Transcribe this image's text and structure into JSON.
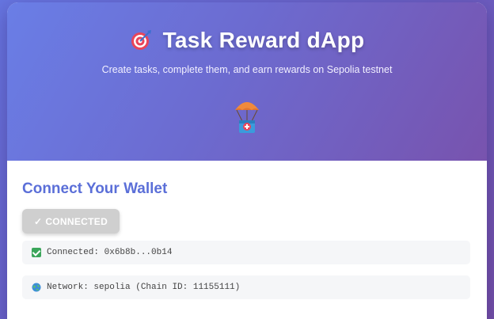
{
  "hero": {
    "title": "Task Reward dApp",
    "subtitle": "Create tasks, complete them, and earn rewards on Sepolia testnet",
    "title_icon": "target-icon",
    "hero_icon": "parachute-icon"
  },
  "wallet": {
    "section_title": "Connect Your Wallet",
    "connect_button_check": "✓",
    "connect_button_label": "CONNECTED",
    "connected_icon": "check-box-icon",
    "connected_label": "Connected:",
    "connected_address": "0x6b8b...0b14",
    "network_icon": "globe-icon",
    "network_label": "Network:",
    "network_value": "sepolia (Chain ID: 11155111)"
  },
  "colors": {
    "accent": "#5b6fd8",
    "hero_start": "#6a7ee6",
    "hero_end": "#7853ae",
    "button_disabled": "#cfcfcf",
    "success": "#3aa55a"
  }
}
